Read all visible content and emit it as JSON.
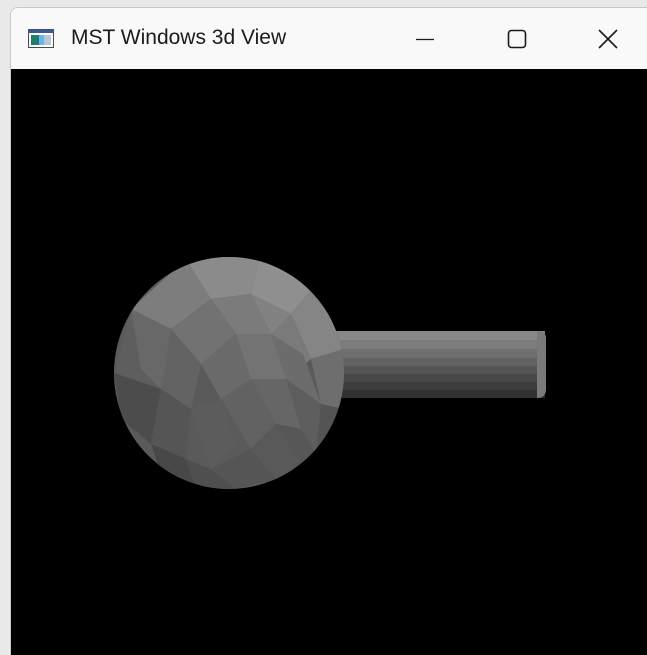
{
  "window": {
    "title": "MST Windows 3d View",
    "icon": "app-window-icon",
    "controls": {
      "minimize_icon": "minimize-icon",
      "maximize_icon": "maximize-icon",
      "close_icon": "close-icon"
    }
  },
  "viewport": {
    "background": "#000000",
    "scene": {
      "objects": [
        "sphere",
        "cylinder"
      ],
      "shading": "flat gray"
    }
  }
}
